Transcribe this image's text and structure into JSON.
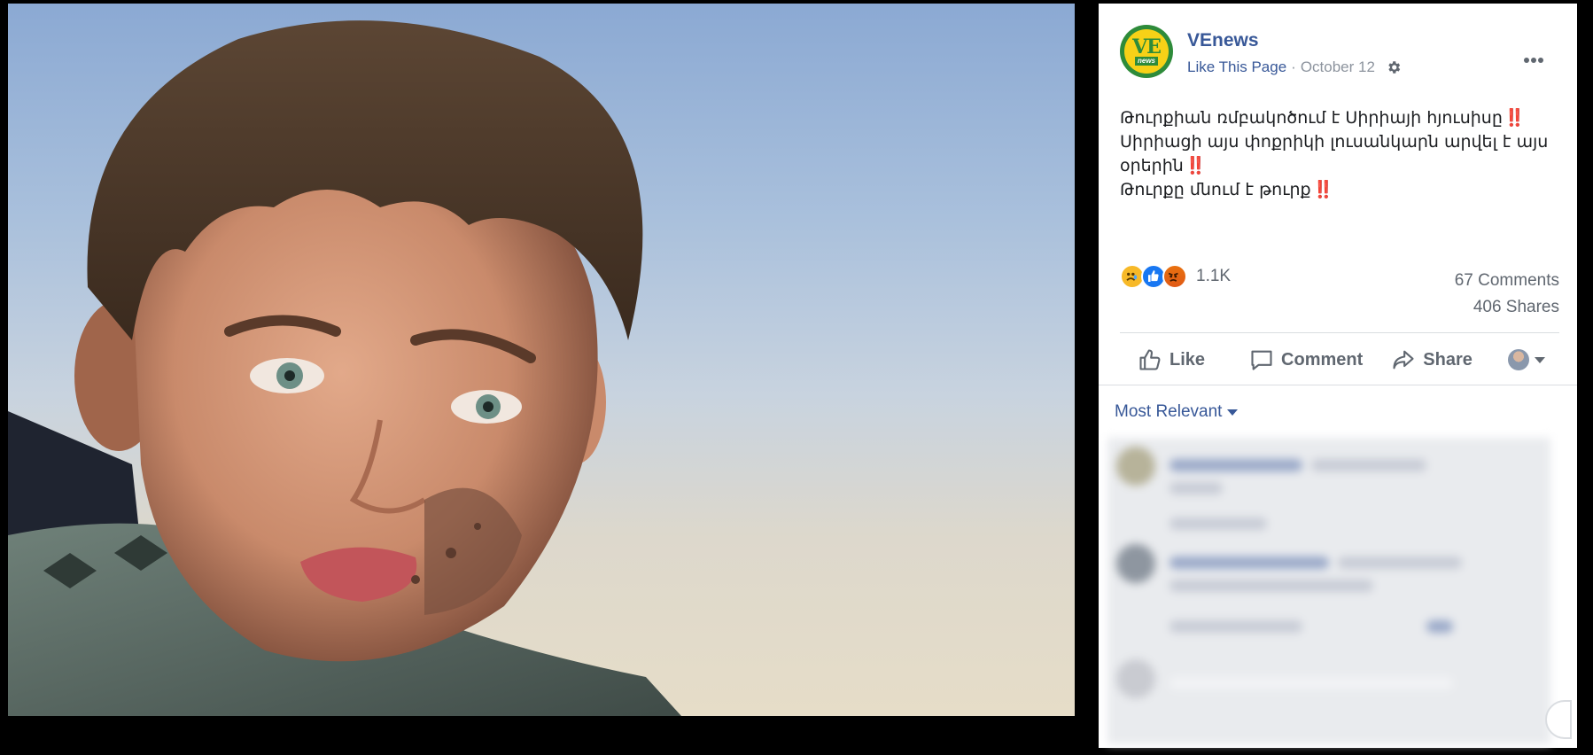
{
  "photo": {
    "alt_subject": "crying-child-photo"
  },
  "post": {
    "page_name": "VEnews",
    "avatar": {
      "line1": "VE",
      "line2": "news"
    },
    "like_page": "Like This Page",
    "separator": "·",
    "date": "October 12",
    "text_lines": [
      "Թուրքիան ռմբակոծում է Սիրիայի հյուսիսը",
      "Սիրիացի այս փոքրիկի լուսանկարն արվել է այս",
      "օրերին",
      "Թուրքը մնում է թուրք"
    ],
    "emphasis_marks": [
      "‼️",
      "‼️",
      "‼️"
    ]
  },
  "stats": {
    "reaction_icons": [
      "sad-reaction-icon",
      "like-reaction-icon",
      "angry-reaction-icon"
    ],
    "reaction_count": "1.1K",
    "comments": "67 Comments",
    "shares": "406 Shares"
  },
  "actions": {
    "like": "Like",
    "comment": "Comment",
    "share": "Share"
  },
  "comments_section": {
    "sort_label": "Most Relevant"
  },
  "colors": {
    "link_blue": "#385898",
    "muted_gray": "#606770",
    "emphasis_red": "#e0245e",
    "avatar_yellow": "#f7d117",
    "avatar_green": "#2e8b3a"
  }
}
